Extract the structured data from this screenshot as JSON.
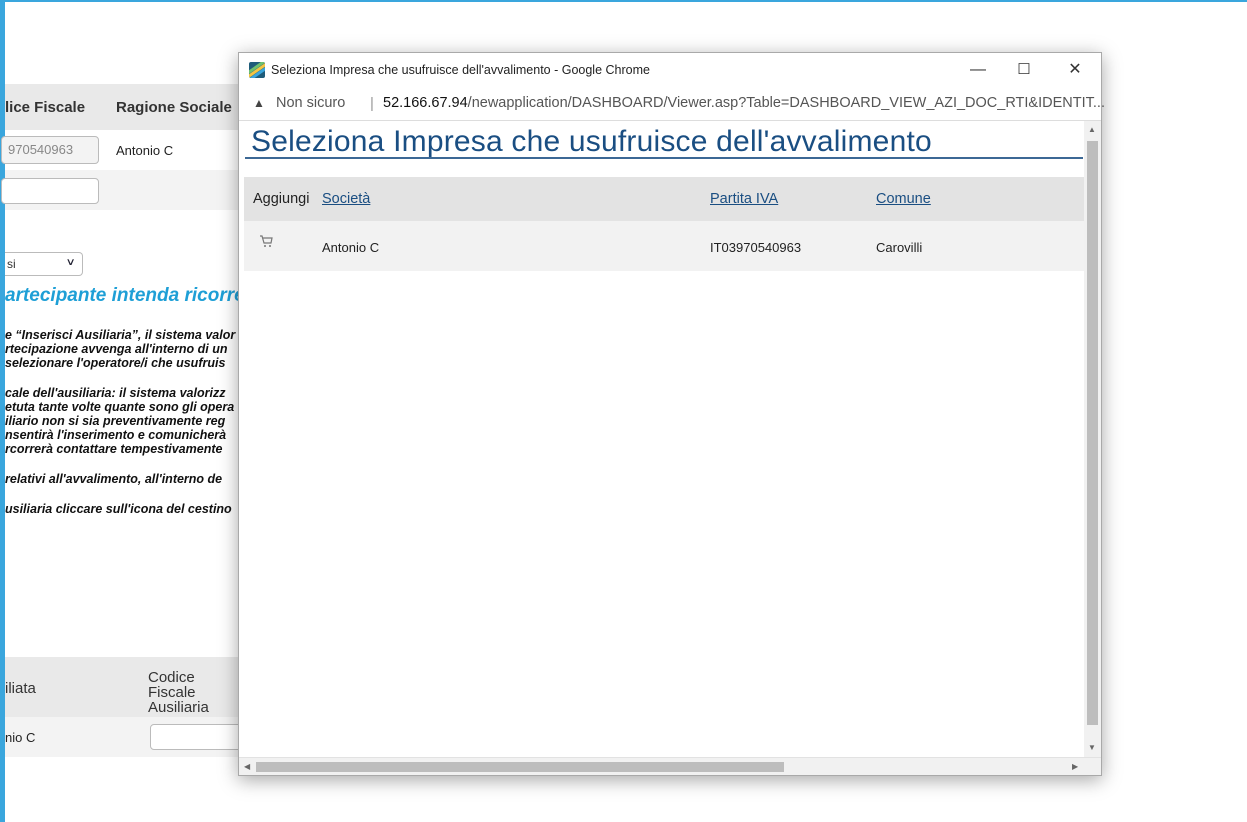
{
  "background": {
    "header": {
      "codice_fiscale": "lice Fiscale",
      "ragione_sociale": "Ragione Sociale"
    },
    "row1": {
      "codice_value": "970540963",
      "ragione_value": "Antonio C"
    },
    "select_value": "si",
    "heading": "artecipante intenda ricorrere",
    "notes": [
      "e “Inserisci Ausiliaria”, il sistema valor",
      "rtecipazione avvenga all'interno di un",
      " selezionare l'operatore/i che usufruis",
      "cale dell'ausiliaria: il sistema valorizz",
      "etuta tante volte quante sono gli opera",
      "iliario non si sia preventivamente reg",
      "nsentirà l'inserimento e comunicherà",
      "rcorrerà contattare tempestivamente",
      "relativi all'avvalimento, all'interno de",
      "usiliaria cliccare sull'icona del cestino"
    ],
    "table_head": {
      "col1": "iliata",
      "col2_line1": "Codice Fiscale",
      "col2_line2": "Ausiliaria"
    },
    "table_row": {
      "col1": "nio C"
    }
  },
  "window": {
    "title": "Seleziona Impresa che usufruisce dell'avvalimento - Google Chrome",
    "buttons": {
      "minimize": "—",
      "maximize": "☐",
      "close": "✕"
    },
    "address": {
      "warning_icon": "warning-triangle-icon",
      "security_label": "Non sicuro",
      "separator": "|",
      "host": "52.166.67.94",
      "path": "/newapplication/DASHBOARD/Viewer.asp?Table=DASHBOARD_VIEW_AZI_DOC_RTI&IDENTIT..."
    }
  },
  "page": {
    "title": "Seleziona Impresa che usufruisce dell'avvalimento",
    "columns": {
      "aggiungi": "Aggiungi",
      "societa": "Società",
      "partita_iva": "Partita IVA",
      "comune": "Comune"
    },
    "rows": [
      {
        "icon": "cart-icon",
        "societa": "Antonio C",
        "partita_iva": "IT03970540963",
        "comune": "Carovilli"
      }
    ]
  },
  "colors": {
    "accent": "#1a4e82",
    "frame": "#3aa6dd",
    "heading_bg": "#1e9fd6"
  }
}
